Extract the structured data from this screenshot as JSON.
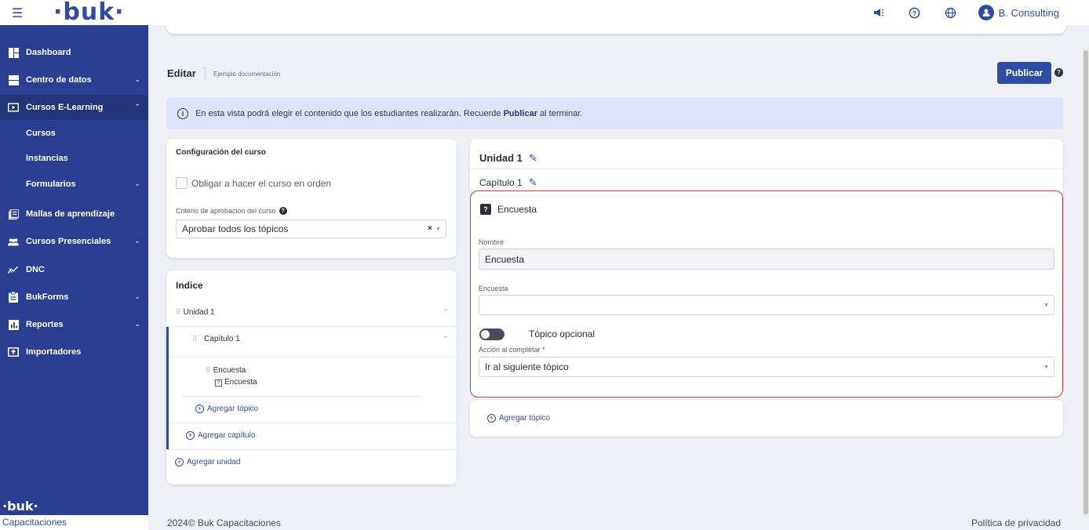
{
  "header": {
    "logo": "·buk·",
    "user_name": "B. Consulting"
  },
  "sidebar": {
    "items": [
      {
        "label": "Dashboard"
      },
      {
        "label": "Centro de datos"
      },
      {
        "label": "Cursos E-Learning"
      },
      {
        "label": "Cursos"
      },
      {
        "label": "Instancias"
      },
      {
        "label": "Formularios"
      },
      {
        "label": "Mallas de aprendizaje"
      },
      {
        "label": "Cursos Presenciales"
      },
      {
        "label": "DNC"
      },
      {
        "label": "BukForms"
      },
      {
        "label": "Reportes"
      },
      {
        "label": "Importadores"
      }
    ],
    "footer_logo": "·buk·",
    "footer_label": "Capacitaciones"
  },
  "page": {
    "title": "Editar",
    "subtitle": "Ejemplo documentación",
    "publish_label": "Publicar"
  },
  "info": {
    "text_before": "En esta vista podrá elegir el contenido que los estudiantes realizarán. Recuerde",
    "text_bold": "Publicar",
    "text_after": "al terminar."
  },
  "config": {
    "title": "Configuración del curso",
    "order_label": "Obligar a hacer el curso en orden",
    "criteria_label": "Criterio de aprobación del curso",
    "criteria_value": "Aprobar todos los tópicos"
  },
  "index": {
    "title": "Indice",
    "unit": "Unidad 1",
    "chapter": "Capítulo 1",
    "topic_name": "Encuesta",
    "topic_type": "Encuesta",
    "add_topic": "Agregar tópico",
    "add_chapter": "Agregar capítulo",
    "add_unit": "Agregar unidad"
  },
  "editor": {
    "unit_title": "Unidad 1",
    "chapter_title": "Capítulo 1",
    "topic_header": "Encuesta",
    "name_label": "Nombre",
    "name_value": "Encuesta",
    "survey_label": "Encuesta",
    "survey_value": "",
    "optional_label": "Tópico opcional",
    "optional_on": false,
    "action_label": "Acción al completar *",
    "action_value": "Ir al siguiente tópico",
    "add_topic": "Agregar tópico"
  },
  "footer": {
    "copyright": "2024© Buk Capacitaciones",
    "privacy": "Política de privacidad"
  }
}
